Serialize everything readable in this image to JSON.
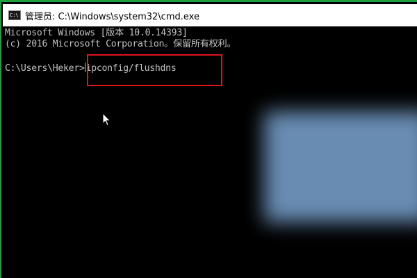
{
  "window": {
    "title": "管理员: C:\\Windows\\system32\\cmd.exe",
    "icon": "cmd-icon",
    "frame_color": "#1ea03c"
  },
  "console": {
    "lines": [
      "Microsoft Windows [版本 10.0.14393]",
      "(c) 2016 Microsoft Corporation。保留所有权利。"
    ],
    "prompt": "C:\\Users\\Heker>",
    "command": "ipconfig/flushdns",
    "text_color": "#c0c0c0",
    "background_color": "#000000"
  },
  "annotation": {
    "highlight_color": "#e0141e"
  },
  "overlay": {
    "color": "#6f94bd"
  }
}
